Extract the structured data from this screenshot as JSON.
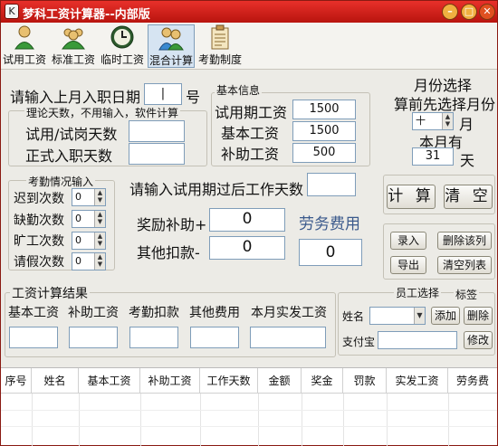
{
  "window": {
    "title": "梦科工资计算器--内部版",
    "logo": "K",
    "min": "–",
    "max": "□",
    "close": "✕"
  },
  "toolbar": [
    {
      "label": "试用工资",
      "icon": "single-person-icon"
    },
    {
      "label": "标准工资",
      "icon": "group-people-icon"
    },
    {
      "label": "临时工资",
      "icon": "clock-icon"
    },
    {
      "label": "混合计算",
      "icon": "people-pair-icon"
    },
    {
      "label": "考勤制度",
      "icon": "clipboard-icon"
    }
  ],
  "entry": {
    "label": "请输入上月入职日期",
    "day_value": "|",
    "day_unit": "号"
  },
  "theory": {
    "title": "理论天数，不用输入，软件计算",
    "trial_label": "试用/试岗天数",
    "formal_label": "正式入职天数"
  },
  "basic": {
    "title": "基本信息",
    "trial_wage_label": "试用期工资",
    "trial_wage": "1500",
    "base_wage_label": "基本工资",
    "base_wage": "1500",
    "subsidy_label": "补助工资",
    "subsidy": "500"
  },
  "month": {
    "title": "月份选择",
    "hint": "算前先选择月份",
    "month_value": "十",
    "month_unit": "月",
    "days_label": "本月有",
    "days_value": "31",
    "days_unit": "天"
  },
  "attendance": {
    "title": "考勤情况输入",
    "rows": [
      {
        "label": "迟到次数",
        "value": "0"
      },
      {
        "label": "缺勤次数",
        "value": "0"
      },
      {
        "label": "旷工次数",
        "value": "0"
      },
      {
        "label": "请假次数",
        "value": "0"
      }
    ]
  },
  "post_trial": {
    "label": "请输入试用期过后工作天数"
  },
  "bonus": {
    "label": "奖励补助+",
    "value": "0"
  },
  "deduct": {
    "label": "其他扣款-",
    "value": "0"
  },
  "labor": {
    "label": "劳务费用",
    "value": "0"
  },
  "actions": {
    "calc": "计 算",
    "clear": "清 空"
  },
  "list_actions": {
    "enter": "录入",
    "delete_row": "删除该列",
    "export": "导出",
    "clear_list": "清空列表"
  },
  "result": {
    "title": "工资计算结果",
    "cols": [
      "基本工资",
      "补助工资",
      "考勤扣款",
      "其他费用",
      "本月实发工资"
    ]
  },
  "employee": {
    "title": "员工选择",
    "tag": "标签",
    "name_label": "姓名",
    "add": "添加",
    "delete": "删除",
    "alipay_label": "支付宝",
    "edit": "修改"
  },
  "table": {
    "headers": [
      "序号",
      "姓名",
      "基本工资",
      "补助工资",
      "工作天数",
      "金额",
      "奖金",
      "罚款",
      "实发工资",
      "劳务费"
    ]
  }
}
